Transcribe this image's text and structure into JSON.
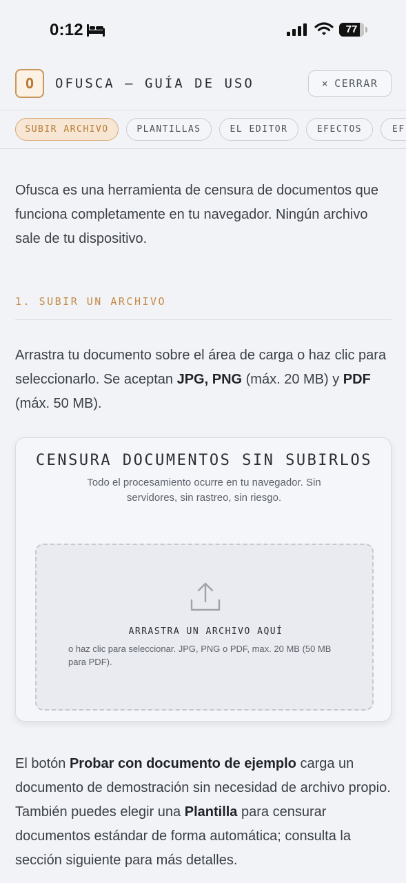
{
  "status_bar": {
    "time": "0:12",
    "battery": "77",
    "icons": [
      "bed-icon",
      "signal-icon",
      "wifi-icon",
      "battery-icon"
    ]
  },
  "header": {
    "logo_letter": "O",
    "title": "OFUSCA — GUÍA DE USO",
    "close_icon": "×",
    "close_label": "CERRAR"
  },
  "tabs": [
    {
      "label": "SUBIR ARCHIVO",
      "active": true
    },
    {
      "label": "PLANTILLAS",
      "active": false
    },
    {
      "label": "EL EDITOR",
      "active": false
    },
    {
      "label": "EFECTOS",
      "active": false
    },
    {
      "label": "EF",
      "active": false
    }
  ],
  "intro": "Ofusca es una herramienta de censura de documentos que funciona completamente en tu navegador. Ningún archivo sale de tu dispositivo.",
  "section": {
    "heading": "1. SUBIR UN ARCHIVO",
    "para_a": "Arrastra tu documento sobre el área de carga o haz clic para seleccionarlo. Se aceptan ",
    "para_b": "JPG, PNG",
    "para_c": " (máx. 20 MB) y ",
    "para_d": "PDF",
    "para_e": " (máx. 50 MB)."
  },
  "card": {
    "title": "CENSURA DOCUMENTOS SIN SUBIRLOS",
    "subtitle": "Todo el procesamiento ocurre en tu navegador. Sin servidores, sin rastreo, sin riesgo.",
    "drop_title": "ARRASTRA UN ARCHIVO AQUÍ",
    "drop_sub": "o haz clic para seleccionar. JPG, PNG o PDF, max. 20 MB (50 MB para PDF)."
  },
  "footer_para": {
    "a": "El botón ",
    "b": "Probar con documento de ejemplo",
    "c": " carga un documento de demostración sin necesidad de archivo propio. También puedes elegir una ",
    "d": "Plantilla",
    "e": " para censurar documentos estándar de forma automática; consulta la sección siguiente para más detalles."
  },
  "colors": {
    "accent": "#c48a45",
    "background": "#f1f3f7"
  }
}
